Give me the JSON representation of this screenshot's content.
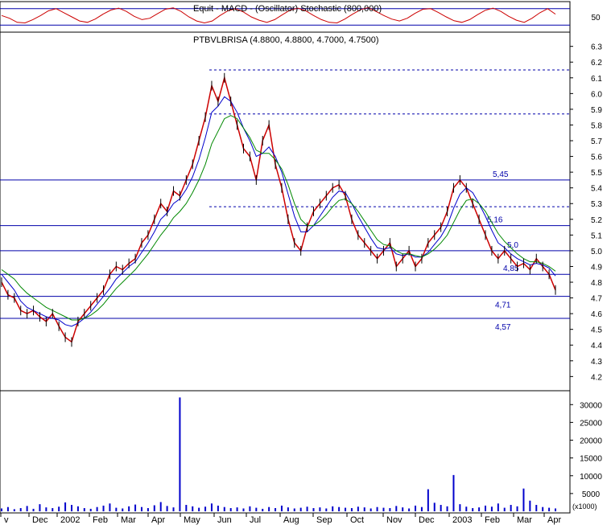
{
  "chart_data": [
    {
      "type": "line",
      "panel": "oscillator",
      "title": "Equit - MACD - (Oscillator) Stochastic (800,000)",
      "ylim": [
        0,
        100
      ],
      "y_ticks": [
        "50"
      ],
      "guide_levels": [
        20,
        80
      ],
      "series": [
        {
          "color": "#cc0000",
          "values": [
            55,
            45,
            30,
            28,
            40,
            55,
            72,
            80,
            65,
            50,
            35,
            30,
            42,
            60,
            75,
            82,
            70,
            52,
            40,
            45,
            62,
            78,
            83,
            70,
            50,
            35,
            28,
            35,
            55,
            72,
            80,
            68,
            50,
            38,
            30,
            40,
            58,
            75,
            82,
            72,
            55,
            40,
            30,
            28,
            42,
            60,
            76,
            84,
            70,
            55,
            42,
            35,
            45,
            63,
            78,
            80,
            66,
            50,
            36,
            30,
            40,
            58,
            74,
            82,
            70,
            52,
            38,
            30,
            45,
            65,
            80,
            60
          ]
        }
      ]
    },
    {
      "type": "line",
      "panel": "price",
      "title": "PTBVLBRISA (4.8800, 4.8800, 4.7000, 4.7500)",
      "ylim": [
        4.12,
        6.37
      ],
      "y_ticks": [
        "4.2",
        "4.3",
        "4.4",
        "4.5",
        "4.6",
        "4.7",
        "4.8",
        "4.9",
        "5.0",
        "5.1",
        "5.2",
        "5.3",
        "5.4",
        "5.5",
        "5.6",
        "5.7",
        "5.8",
        "5.9",
        "6.0",
        "6.1",
        "6.2",
        "6.3"
      ],
      "x_labels": [
        "v",
        "Dec",
        "2002",
        "Feb",
        "Mar",
        "Apr",
        "May",
        "Jun",
        "Jul",
        "Aug",
        "Sep",
        "Oct",
        "Nov",
        "Dec",
        "2003",
        "Feb",
        "Mar",
        "Apr"
      ],
      "levels": [
        {
          "value": 5.45,
          "label": "5,45",
          "style": "solid"
        },
        {
          "value": 5.16,
          "label": "5,16",
          "style": "solid"
        },
        {
          "value": 5.0,
          "label": "5,0",
          "style": "solid"
        },
        {
          "value": 4.85,
          "label": "4,85",
          "style": "solid"
        },
        {
          "value": 4.71,
          "label": "4,71",
          "style": "solid"
        },
        {
          "value": 4.57,
          "label": "4,57",
          "style": "solid"
        },
        {
          "value": 6.15,
          "label": "",
          "style": "dashed"
        },
        {
          "value": 5.87,
          "label": "",
          "style": "dashed"
        },
        {
          "value": 5.28,
          "label": "",
          "style": "dashed"
        }
      ],
      "series": [
        {
          "color": "#cc0000",
          "role": "close",
          "values": [
            4.8,
            4.72,
            4.7,
            4.62,
            4.6,
            4.62,
            4.58,
            4.55,
            4.6,
            4.52,
            4.45,
            4.42,
            4.55,
            4.6,
            4.65,
            4.7,
            4.75,
            4.85,
            4.9,
            4.88,
            4.92,
            4.95,
            5.05,
            5.1,
            5.2,
            5.3,
            5.25,
            5.38,
            5.35,
            5.45,
            5.55,
            5.7,
            5.85,
            6.05,
            5.95,
            6.1,
            5.95,
            5.8,
            5.65,
            5.6,
            5.45,
            5.7,
            5.8,
            5.55,
            5.4,
            5.2,
            5.05,
            5.0,
            5.15,
            5.25,
            5.3,
            5.35,
            5.4,
            5.42,
            5.35,
            5.2,
            5.1,
            5.05,
            5.0,
            4.95,
            5.0,
            5.05,
            4.9,
            4.95,
            5.0,
            4.9,
            4.95,
            5.05,
            5.1,
            5.15,
            5.25,
            5.4,
            5.45,
            5.4,
            5.3,
            5.2,
            5.1,
            5.0,
            4.95,
            5.0,
            4.95,
            4.9,
            4.92,
            4.88,
            4.95,
            4.9,
            4.85,
            4.75
          ]
        },
        {
          "color": "#0000cc",
          "role": "moving average",
          "values": [
            4.85,
            4.8,
            4.75,
            4.68,
            4.64,
            4.62,
            4.6,
            4.58,
            4.57,
            4.56,
            4.53,
            4.52,
            4.54,
            4.57,
            4.61,
            4.66,
            4.71,
            4.76,
            4.82,
            4.86,
            4.9,
            4.93,
            4.99,
            5.05,
            5.12,
            5.2,
            5.24,
            5.3,
            5.33,
            5.39,
            5.47,
            5.58,
            5.72,
            5.88,
            5.92,
            5.98,
            5.95,
            5.88,
            5.78,
            5.7,
            5.6,
            5.62,
            5.66,
            5.6,
            5.5,
            5.36,
            5.22,
            5.12,
            5.12,
            5.16,
            5.22,
            5.28,
            5.34,
            5.38,
            5.37,
            5.3,
            5.22,
            5.15,
            5.08,
            5.02,
            5.01,
            5.02,
            4.98,
            4.97,
            4.98,
            4.96,
            4.96,
            4.99,
            5.04,
            5.09,
            5.16,
            5.27,
            5.36,
            5.4,
            5.37,
            5.3,
            5.22,
            5.13,
            5.05,
            5.02,
            4.98,
            4.95,
            4.93,
            4.91,
            4.92,
            4.91,
            4.89,
            4.84
          ]
        },
        {
          "color": "#008800",
          "role": "moving average",
          "values": [
            4.88,
            4.85,
            4.82,
            4.77,
            4.73,
            4.7,
            4.67,
            4.64,
            4.62,
            4.6,
            4.58,
            4.56,
            4.56,
            4.57,
            4.59,
            4.62,
            4.66,
            4.71,
            4.76,
            4.8,
            4.84,
            4.88,
            4.93,
            4.98,
            5.04,
            5.1,
            5.15,
            5.21,
            5.25,
            5.3,
            5.37,
            5.45,
            5.55,
            5.68,
            5.76,
            5.84,
            5.86,
            5.84,
            5.78,
            5.72,
            5.64,
            5.62,
            5.62,
            5.58,
            5.52,
            5.42,
            5.3,
            5.2,
            5.16,
            5.16,
            5.19,
            5.23,
            5.28,
            5.32,
            5.33,
            5.3,
            5.25,
            5.19,
            5.13,
            5.07,
            5.04,
            5.03,
            5.0,
            4.98,
            4.98,
            4.97,
            4.96,
            4.98,
            5.01,
            5.05,
            5.1,
            5.18,
            5.26,
            5.32,
            5.33,
            5.3,
            5.25,
            5.18,
            5.11,
            5.06,
            5.02,
            4.98,
            4.95,
            4.93,
            4.93,
            4.92,
            4.9,
            4.87
          ]
        }
      ]
    },
    {
      "type": "bar",
      "panel": "volume",
      "ylim": [
        0,
        33000
      ],
      "y_ticks": [
        "5000",
        "10000",
        "15000",
        "20000",
        "25000",
        "30000"
      ],
      "unit_label": "(x1000)",
      "values": [
        800,
        1200,
        600,
        900,
        1500,
        700,
        2000,
        1100,
        900,
        1300,
        2500,
        1800,
        1400,
        900,
        700,
        1200,
        1600,
        2200,
        1000,
        800,
        1400,
        1900,
        1200,
        900,
        1700,
        2600,
        1500,
        1100,
        32000,
        1800,
        1400,
        1000,
        1300,
        2200,
        1600,
        1200,
        900,
        1100,
        800,
        1400,
        1000,
        700,
        1200,
        900,
        1600,
        1100,
        800,
        1000,
        1300,
        900,
        1100,
        800,
        1400,
        1200,
        1000,
        900,
        1300,
        1100,
        800,
        1200,
        1000,
        900,
        1500,
        1100,
        800,
        1600,
        1200,
        6200,
        2400,
        1800,
        1400,
        10200,
        2000,
        1300,
        900,
        1100,
        1600,
        1300,
        2200,
        1000,
        1800,
        1400,
        6400,
        3000,
        1800,
        1200,
        1000,
        800
      ]
    }
  ]
}
